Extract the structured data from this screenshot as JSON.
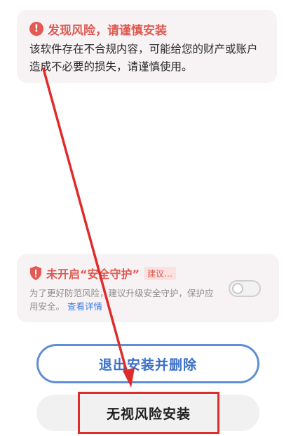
{
  "risk_card": {
    "title": "发现风险，请谨慎安装",
    "body": "该软件存在不合规内容，可能给您的财产或账户造成不必要的损失，请谨慎使用。",
    "icon": "exclamation-icon"
  },
  "guard_card": {
    "title": "未开启“安全守护”",
    "badge": "建议…",
    "desc": "为了更好防范风险，建议升级安全守护，保护应用安全。",
    "link": "查看详情",
    "toggle_on": false,
    "icon": "shield-icon"
  },
  "buttons": {
    "exit_label": "退出安装并删除",
    "ignore_label": "无视风险安装"
  },
  "colors": {
    "warning_red": "#df5a52",
    "link_blue": "#3d7be0",
    "exit_button_blue": "#5e8fd6",
    "annotation_red": "#e02b2b"
  }
}
